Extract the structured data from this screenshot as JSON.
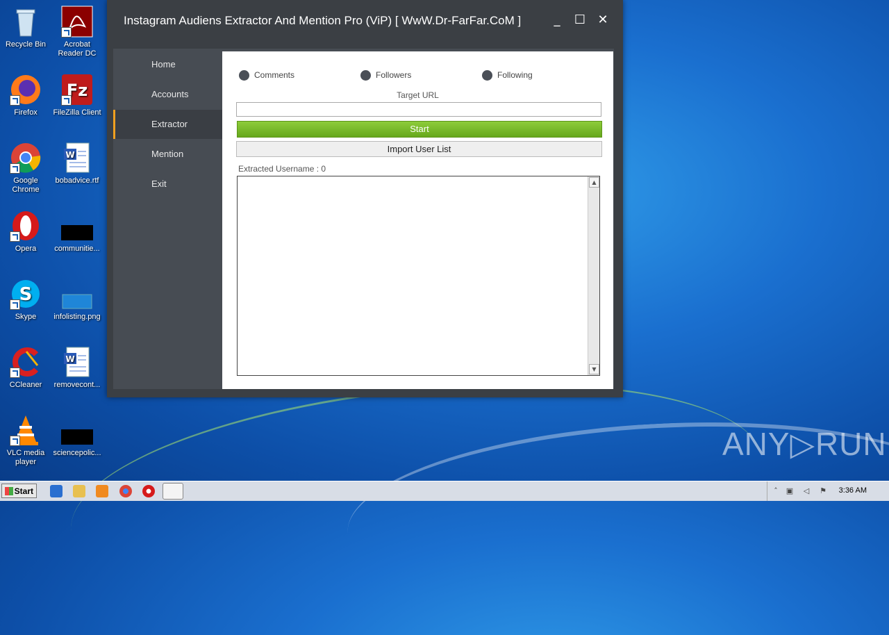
{
  "desktop": {
    "icons": [
      {
        "label": "Recycle Bin",
        "icon": "recycle-bin-icon"
      },
      {
        "label": "Acrobat Reader DC",
        "icon": "acrobat-icon"
      },
      {
        "label": "Firefox",
        "icon": "firefox-icon"
      },
      {
        "label": "FileZilla Client",
        "icon": "filezilla-icon"
      },
      {
        "label": "Google Chrome",
        "icon": "chrome-icon"
      },
      {
        "label": "bobadvice.rtf",
        "icon": "word-document-icon"
      },
      {
        "label": "Opera",
        "icon": "opera-icon"
      },
      {
        "label": "communitie...",
        "icon": "black-file-icon"
      },
      {
        "label": "Skype",
        "icon": "skype-icon"
      },
      {
        "label": "infolisting.png",
        "icon": "image-file-icon"
      },
      {
        "label": "CCleaner",
        "icon": "ccleaner-icon"
      },
      {
        "label": "removecont...",
        "icon": "word-document-icon"
      },
      {
        "label": "VLC media player",
        "icon": "vlc-icon"
      },
      {
        "label": "sciencepolic...",
        "icon": "black-file-icon"
      }
    ],
    "watermark": "ANY▷RUN"
  },
  "window": {
    "title": "Instagram Audiens Extractor And Mention Pro (ViP) [ WwW.Dr-FarFar.CoM ]",
    "controls": {
      "minimize": "_",
      "maximize": "☐",
      "close": "✕"
    }
  },
  "nav": {
    "items": [
      {
        "label": "Home"
      },
      {
        "label": "Accounts"
      },
      {
        "label": "Extractor",
        "active": true
      },
      {
        "label": "Mention"
      },
      {
        "label": "Exit"
      }
    ]
  },
  "extractor": {
    "radios": [
      {
        "label": "Comments"
      },
      {
        "label": "Followers"
      },
      {
        "label": "Following"
      }
    ],
    "target_url_label": "Target URL",
    "target_url_value": "",
    "start_label": "Start",
    "import_label": "Import User List",
    "extracted_label": "Extracted Username : 0"
  },
  "taskbar": {
    "start_label": "Start",
    "clock": "3:36 AM"
  }
}
